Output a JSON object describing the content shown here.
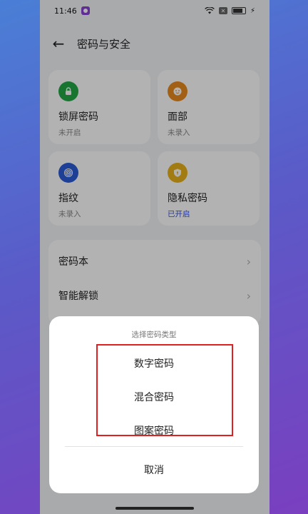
{
  "status_bar": {
    "time": "11:46"
  },
  "header": {
    "title": "密码与安全"
  },
  "cards": [
    {
      "title": "锁屏密码",
      "subtitle": "未开启",
      "icon": "lock-icon",
      "color": "#22a845"
    },
    {
      "title": "面部",
      "subtitle": "未录入",
      "icon": "face-icon",
      "color": "#e98a1d"
    },
    {
      "title": "指纹",
      "subtitle": "未录入",
      "icon": "fingerprint-icon",
      "color": "#2a5bd7"
    },
    {
      "title": "隐私密码",
      "subtitle": "已开启",
      "icon": "privacy-shield-icon",
      "color": "#e8b21a"
    }
  ],
  "list": [
    {
      "label": "密码本"
    },
    {
      "label": "智能解锁"
    }
  ],
  "sheet": {
    "title": "选择密码类型",
    "options": [
      "数字密码",
      "混合密码",
      "图案密码"
    ],
    "cancel": "取消"
  },
  "colors": {
    "highlight": "#e02020",
    "active_text": "#3450d8"
  }
}
